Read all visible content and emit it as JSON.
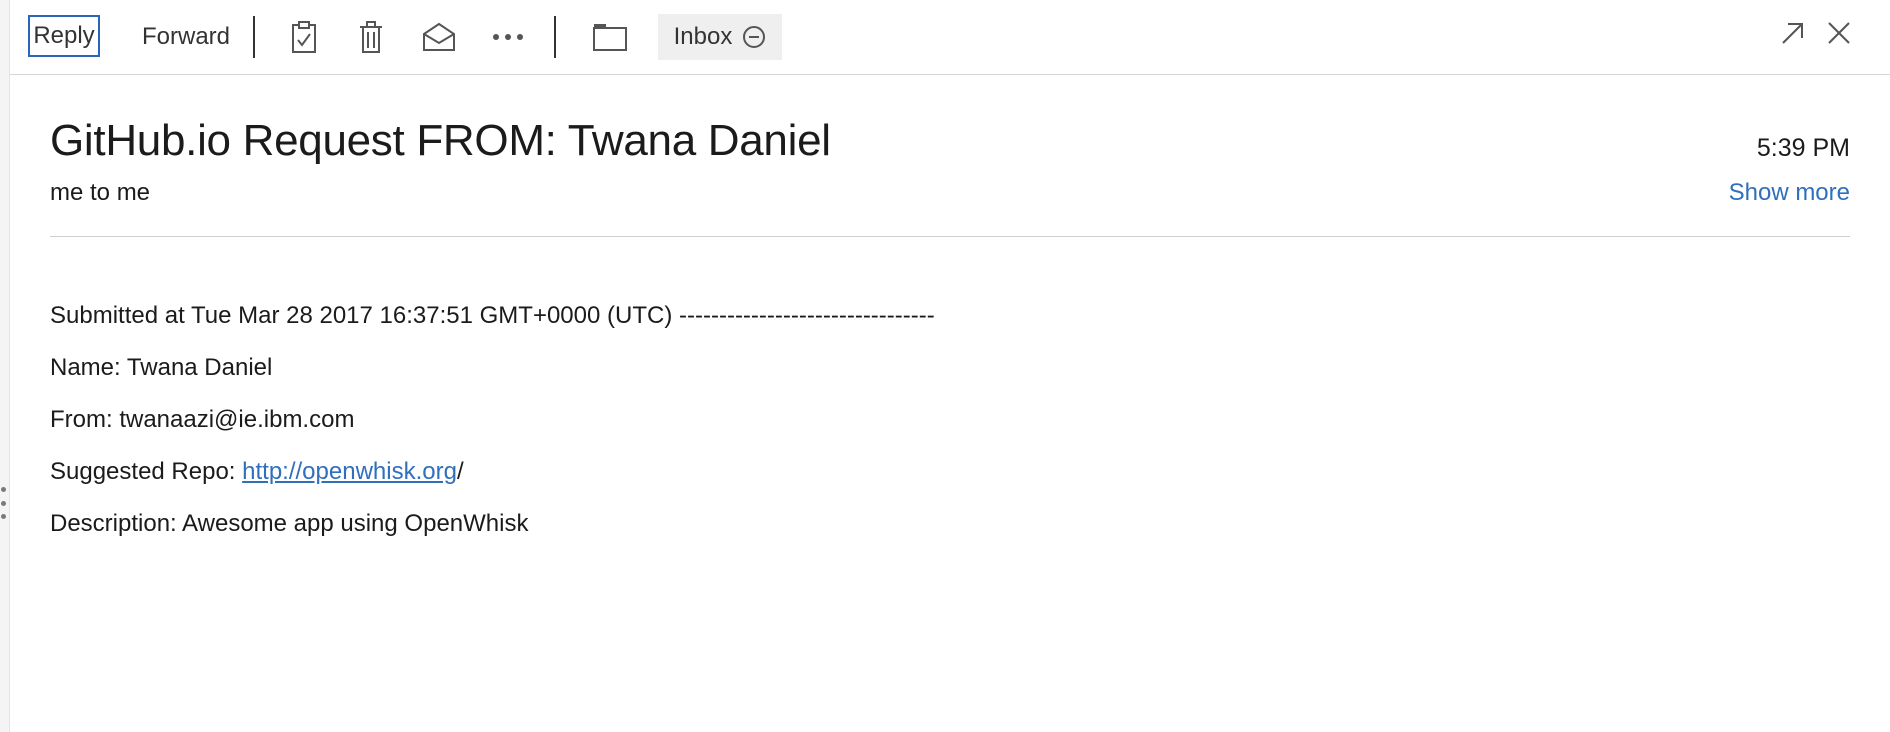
{
  "toolbar": {
    "reply_label": "Reply",
    "forward_label": "Forward",
    "folder_chip_label": "Inbox",
    "icons": [
      "clipboard-check-icon",
      "trash-icon",
      "open-envelope-icon",
      "more-icon",
      "folder-icon",
      "remove-circle-icon",
      "expand-icon",
      "close-icon"
    ]
  },
  "message": {
    "subject": "GitHub.io Request FROM: Twana Daniel",
    "time": "5:39 PM",
    "from_to": "me to me",
    "show_more_label": "Show more",
    "body": {
      "submitted": "Submitted at Tue Mar 28 2017 16:37:51 GMT+0000 (UTC) --------------------------------",
      "name": "Name: Twana Daniel",
      "from": "From: twanaazi@ie.ibm.com",
      "repo_prefix": "Suggested Repo: ",
      "repo_link": "http://openwhisk.org",
      "repo_suffix": "/",
      "description": "Description: Awesome app using OpenWhisk"
    }
  },
  "colors": {
    "accent": "#2a66b8",
    "link": "#2f6fbd",
    "text": "#1b1b1b",
    "chip_bg": "#efefef"
  }
}
